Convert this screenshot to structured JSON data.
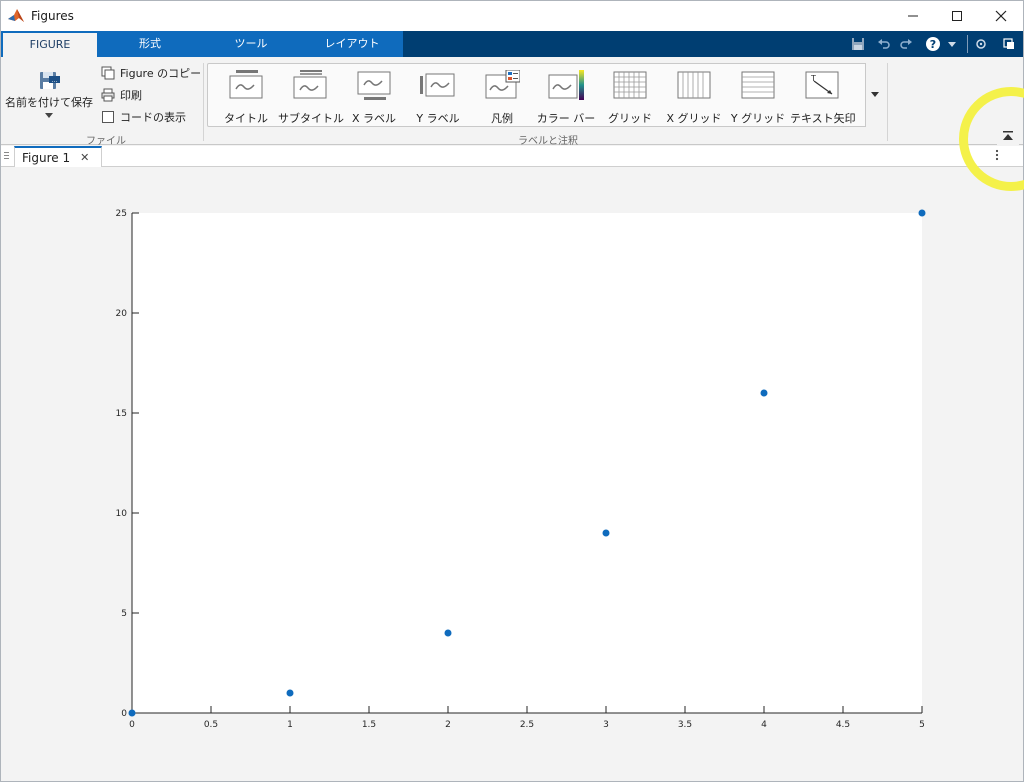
{
  "window": {
    "title": "Figures",
    "minimize_icon": "minimize-icon",
    "maximize_icon": "maximize-icon",
    "close_icon": "close-icon"
  },
  "ribbon_tabs": [
    {
      "label": "FIGURE",
      "active": true
    },
    {
      "label": "形式",
      "active": false
    },
    {
      "label": "ツール",
      "active": false
    },
    {
      "label": "レイアウト",
      "active": false
    }
  ],
  "quick_access": [
    "save-icon",
    "undo-icon",
    "redo-icon",
    "help-icon",
    "dropdown-icon",
    "options-icon",
    "undock-icon"
  ],
  "file_group": {
    "save_as_label": "名前を付けて保存",
    "copy_figure_label": "Figure のコピー",
    "print_label": "印刷",
    "show_code_label": "コードの表示",
    "group_label": "ファイル"
  },
  "annotation_group": {
    "items": [
      {
        "label": "タイトル",
        "icon": "title-icon"
      },
      {
        "label": "サブタイトル",
        "icon": "subtitle-icon"
      },
      {
        "label": "X ラベル",
        "icon": "xlabel-icon"
      },
      {
        "label": "Y ラベル",
        "icon": "ylabel-icon"
      },
      {
        "label": "凡例",
        "icon": "legend-icon"
      },
      {
        "label": "カラー バー",
        "icon": "colorbar-icon"
      },
      {
        "label": "グリッド",
        "icon": "grid-icon"
      },
      {
        "label": "X グリッド",
        "icon": "xgrid-icon"
      },
      {
        "label": "Y グリッド",
        "icon": "ygrid-icon"
      },
      {
        "label": "テキスト矢印",
        "icon": "text-arrow-icon"
      }
    ],
    "group_label": "ラベルと注釈"
  },
  "document_tab": {
    "label": "Figure 1",
    "close_symbol": "✕"
  },
  "colors": {
    "accent": "#0f6bbd",
    "ribbon_dark": "#003e72",
    "marker": "#0f6bbd",
    "highlight": "#f4f14a"
  },
  "chart_data": {
    "type": "scatter",
    "x": [
      0,
      1,
      2,
      3,
      4,
      5
    ],
    "y": [
      0,
      1,
      4,
      9,
      16,
      25
    ],
    "xlim": [
      0,
      5
    ],
    "ylim": [
      0,
      25
    ],
    "x_ticks": [
      "0",
      "0.5",
      "1",
      "1.5",
      "2",
      "2.5",
      "3",
      "3.5",
      "4",
      "4.5",
      "5"
    ],
    "y_ticks": [
      "0",
      "5",
      "10",
      "15",
      "20",
      "25"
    ],
    "title": "",
    "xlabel": "",
    "ylabel": "",
    "grid": false,
    "marker_color": "#0f6bbd"
  }
}
